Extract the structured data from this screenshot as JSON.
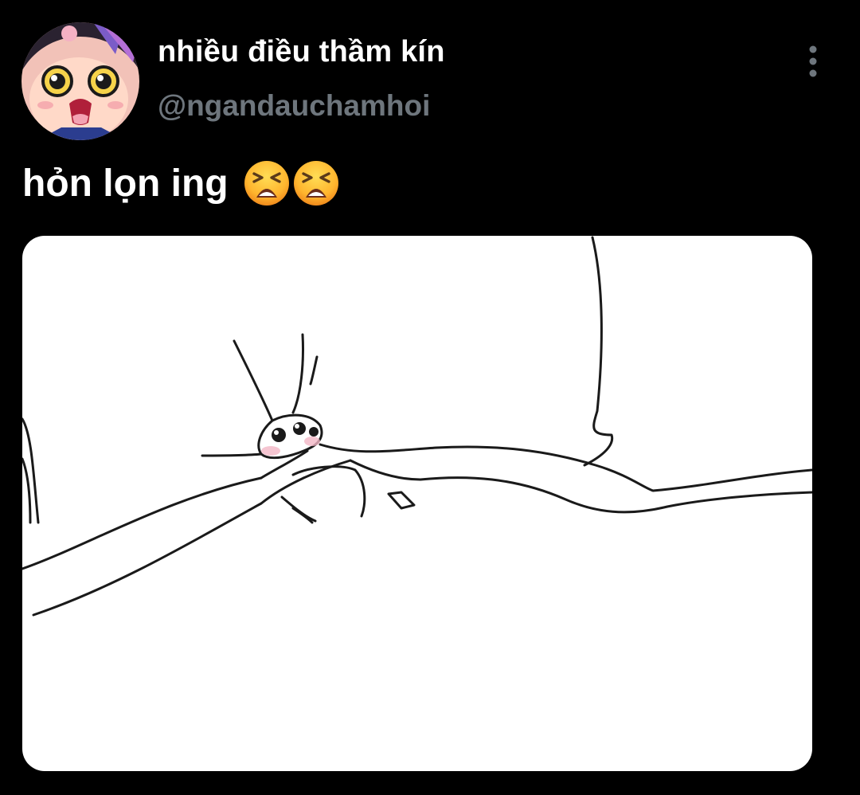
{
  "tweet": {
    "display_name": "nhiều điều thầm kín",
    "handle": "@ngandauchamhoi",
    "text": "hỏn lọn ing",
    "emojis": [
      "tired-face",
      "tired-face"
    ]
  },
  "icons": {
    "more": "vertical-ellipsis-icon"
  },
  "colors": {
    "background": "#000000",
    "text_primary": "#ffffff",
    "text_secondary": "#6e767d",
    "more_icon": "#6e767d"
  }
}
